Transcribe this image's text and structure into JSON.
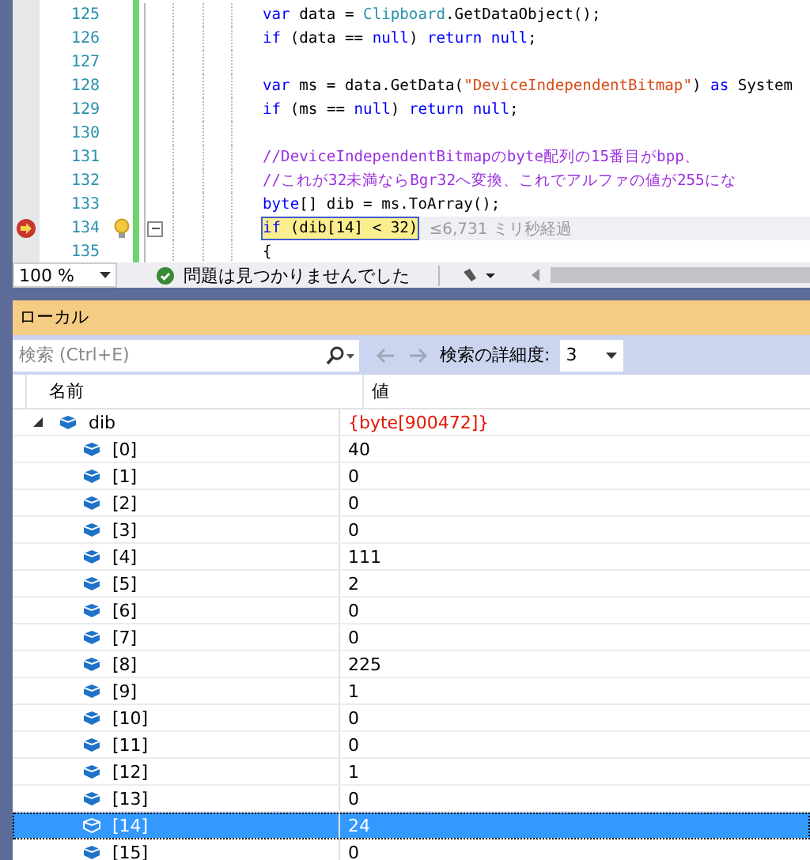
{
  "editor": {
    "lines": [
      {
        "number": "125",
        "current": false,
        "collapsible": false,
        "tokens": [
          {
            "kind": "kw",
            "text": "var"
          },
          {
            "kind": "plain",
            "text": " data = "
          },
          {
            "kind": "type",
            "text": "Clipboard"
          },
          {
            "kind": "plain",
            "text": ".GetDataObject();"
          }
        ]
      },
      {
        "number": "126",
        "current": false,
        "collapsible": false,
        "tokens": [
          {
            "kind": "kw",
            "text": "if"
          },
          {
            "kind": "plain",
            "text": " (data == "
          },
          {
            "kind": "kw",
            "text": "null"
          },
          {
            "kind": "plain",
            "text": ") "
          },
          {
            "kind": "kw",
            "text": "return null"
          },
          {
            "kind": "plain",
            "text": ";"
          }
        ]
      },
      {
        "number": "127",
        "current": false,
        "collapsible": false
      },
      {
        "number": "128",
        "current": false,
        "collapsible": false,
        "tokens": [
          {
            "kind": "kw",
            "text": "var"
          },
          {
            "kind": "plain",
            "text": " ms = data.GetData("
          },
          {
            "kind": "str",
            "text": "\"DeviceIndependentBitmap\""
          },
          {
            "kind": "plain",
            "text": ") "
          },
          {
            "kind": "kw",
            "text": "as"
          },
          {
            "kind": "plain",
            "text": " System"
          }
        ]
      },
      {
        "number": "129",
        "current": false,
        "collapsible": false,
        "tokens": [
          {
            "kind": "kw",
            "text": "if"
          },
          {
            "kind": "plain",
            "text": " (ms == "
          },
          {
            "kind": "kw",
            "text": "null"
          },
          {
            "kind": "plain",
            "text": ") "
          },
          {
            "kind": "kw",
            "text": "return null"
          },
          {
            "kind": "plain",
            "text": ";"
          }
        ]
      },
      {
        "number": "130",
        "current": false,
        "collapsible": false
      },
      {
        "number": "131",
        "current": false,
        "collapsible": false,
        "tokens": [
          {
            "kind": "comment",
            "text": "//DeviceIndependentBitmapのbyte配列の15番目がbpp、"
          }
        ]
      },
      {
        "number": "132",
        "current": false,
        "collapsible": false,
        "tokens": [
          {
            "kind": "comment",
            "text": "//これが32未満ならBgr32へ変換、これでアルファの値が255にな"
          }
        ]
      },
      {
        "number": "133",
        "current": false,
        "collapsible": false,
        "tokens": [
          {
            "kind": "kw",
            "text": "byte"
          },
          {
            "kind": "plain",
            "text": "[] dib = ms.ToArray();"
          }
        ]
      },
      {
        "number": "134",
        "current": true,
        "collapsible": true,
        "hint": "≤6,731 ミリ秒経過",
        "tokens": [
          {
            "kind": "kw",
            "text": "if"
          },
          {
            "kind": "plain",
            "text": " (dib[14] < 32)"
          }
        ]
      },
      {
        "number": "135",
        "current": false,
        "collapsible": false,
        "tokens": [
          {
            "kind": "plain",
            "text": "{"
          }
        ]
      }
    ]
  },
  "status_bar": {
    "zoom": "100 %",
    "message": "問題は見つかりませんでした"
  },
  "locals": {
    "title": "ローカル",
    "search": {
      "placeholder": "検索 (Ctrl+E)"
    },
    "depth_label": "検索の詳細度:",
    "depth": "3",
    "columns": [
      "名前",
      "値"
    ],
    "rows": [
      {
        "name": "dib",
        "value": "{byte[900472]}",
        "expanded": true,
        "selected": false,
        "changed": true,
        "children": [
          {
            "name": "[0]",
            "value": "40",
            "selected": false,
            "changed": false
          },
          {
            "name": "[1]",
            "value": "0",
            "selected": false,
            "changed": false
          },
          {
            "name": "[2]",
            "value": "0",
            "selected": false,
            "changed": false
          },
          {
            "name": "[3]",
            "value": "0",
            "selected": false,
            "changed": false
          },
          {
            "name": "[4]",
            "value": "111",
            "selected": false,
            "changed": false
          },
          {
            "name": "[5]",
            "value": "2",
            "selected": false,
            "changed": false
          },
          {
            "name": "[6]",
            "value": "0",
            "selected": false,
            "changed": false
          },
          {
            "name": "[7]",
            "value": "0",
            "selected": false,
            "changed": false
          },
          {
            "name": "[8]",
            "value": "225",
            "selected": false,
            "changed": false
          },
          {
            "name": "[9]",
            "value": "1",
            "selected": false,
            "changed": false
          },
          {
            "name": "[10]",
            "value": "0",
            "selected": false,
            "changed": false
          },
          {
            "name": "[11]",
            "value": "0",
            "selected": false,
            "changed": false
          },
          {
            "name": "[12]",
            "value": "1",
            "selected": false,
            "changed": false
          },
          {
            "name": "[13]",
            "value": "0",
            "selected": false,
            "changed": false
          },
          {
            "name": "[14]",
            "value": "24",
            "selected": true,
            "changed": false
          },
          {
            "name": "[15]",
            "value": "0",
            "selected": false,
            "changed": false
          }
        ]
      }
    ]
  }
}
